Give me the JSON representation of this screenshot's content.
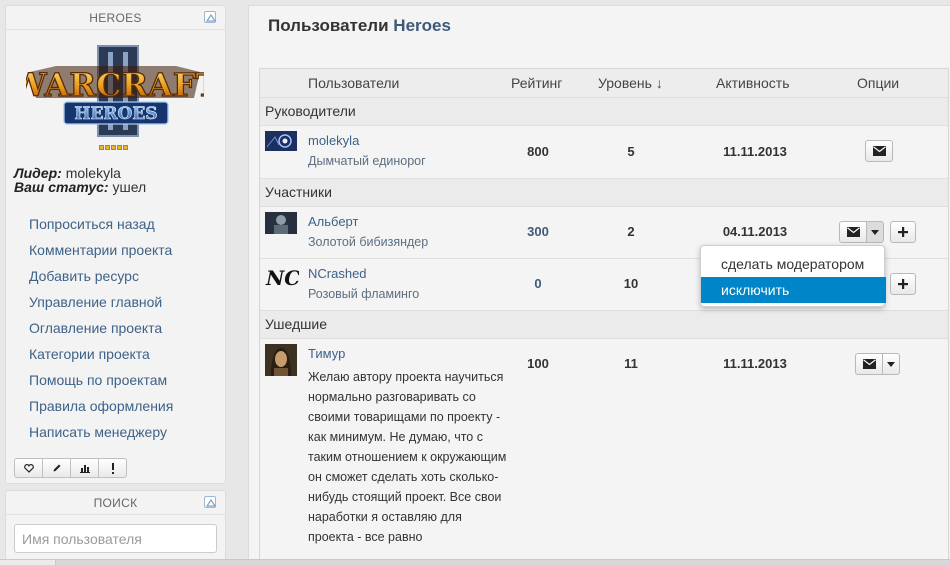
{
  "sidebar": {
    "project_panel_title": "HEROES",
    "leader_label": "Лидер:",
    "leader_value": "molekyla",
    "status_label": "Ваш статус:",
    "status_value": "ушел",
    "menu": [
      "Попроситься назад",
      "Комментарии проекта",
      "Добавить ресурс",
      "Управление главной",
      "Оглавление проекта",
      "Категории проекта",
      "Помощь по проектам",
      "Правила оформления",
      "Написать менеджеру"
    ],
    "tool_icons": [
      "heart-icon",
      "edit-icon",
      "stats-icon",
      "alert-icon"
    ],
    "search_panel_title": "ПОИСК",
    "search_placeholder": "Имя пользователя"
  },
  "main": {
    "title_prefix": "Пользователи",
    "title_accent": "Heroes",
    "columns": {
      "users": "Пользователи",
      "rating": "Рейтинг",
      "level": "Уровень ↓",
      "activity": "Активность",
      "options": "Опции"
    },
    "groups": {
      "leaders": "Руководители",
      "members": "Участники",
      "left": "Ушедшие"
    },
    "rows": {
      "molekyla": {
        "name": "molekyla",
        "title": "Дымчатый единорог",
        "rating": "800",
        "level": "5",
        "activity": "11.11.2013"
      },
      "albert": {
        "name": "Альберт",
        "title": "Золотой бибизяндер",
        "rating": "300",
        "level": "2",
        "activity": "04.11.2013"
      },
      "ncrashed": {
        "name": "NCrashed",
        "title": "Розовый фламинго",
        "rating": "0",
        "level": "10",
        "activity": ""
      },
      "timur": {
        "name": "Тимур",
        "comment": "Желаю автору проекта научиться нормально разговаривать со своими товарищами по проекту - как минимум. Не думаю, что с таким отношением к окружающим он сможет сделать хоть сколько-нибудь стоящий проект. Все свои наработки я оставляю для проекта - все равно",
        "rating": "100",
        "level": "11",
        "activity": "11.11.2013"
      }
    },
    "dropdown": {
      "make_moderator": "сделать модератором",
      "exclude": "исключить"
    }
  },
  "colors": {
    "link": "#3e6288",
    "accent_title": "#3e5a78",
    "dropdown_active": "#0085c8"
  }
}
